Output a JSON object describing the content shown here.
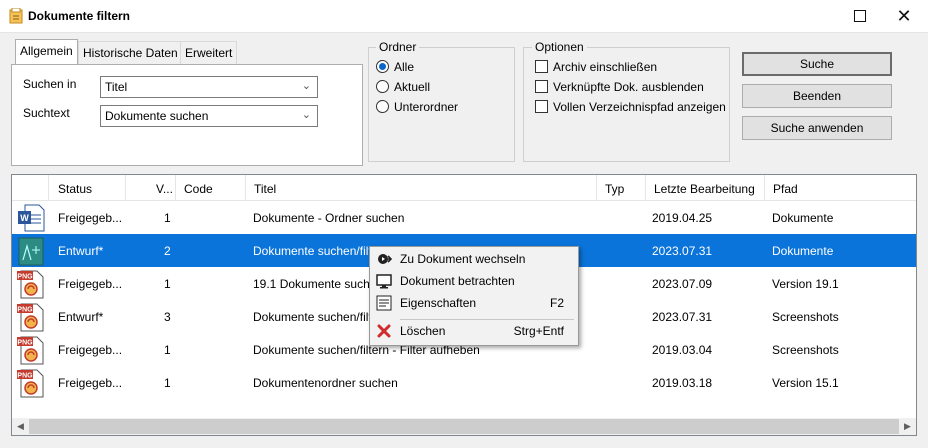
{
  "window": {
    "title": "Dokumente filtern",
    "close_glyph": "✕"
  },
  "tabs": [
    {
      "label": "Allgemein",
      "active": true
    },
    {
      "label": "Historische Daten",
      "active": false
    },
    {
      "label": "Erweitert",
      "active": false
    }
  ],
  "search": {
    "in_label": "Suchen in",
    "in_value": "Titel",
    "text_label": "Suchtext",
    "text_value": "Dokumente suchen"
  },
  "ordner": {
    "legend": "Ordner",
    "options": [
      {
        "label": "Alle",
        "selected": true
      },
      {
        "label": "Aktuell",
        "selected": false
      },
      {
        "label": "Unterordner",
        "selected": false
      }
    ]
  },
  "optionen": {
    "legend": "Optionen",
    "options": [
      {
        "label": "Archiv einschließen",
        "checked": false
      },
      {
        "label": "Verknüpfte Dok. ausblenden",
        "checked": false
      },
      {
        "label": "Vollen Verzeichnispfad anzeigen",
        "checked": false
      }
    ]
  },
  "buttons": {
    "suche": "Suche",
    "beenden": "Beenden",
    "anwenden": "Suche anwenden"
  },
  "list": {
    "columns": [
      "Status",
      "V...",
      "Code",
      "Titel",
      "Typ",
      "Letzte Bearbeitung",
      "Pfad"
    ],
    "rows": [
      {
        "icon": "word-document-icon",
        "status": "Freigegeb...",
        "version": "1",
        "code": "",
        "title": "Dokumente - Ordner suchen",
        "type": "",
        "date": "2019.04.25",
        "path": "Dokumente",
        "selected": false
      },
      {
        "icon": "drawing-document-icon",
        "status": "Entwurf*",
        "version": "2",
        "code": "",
        "title": "Dokumente suchen/filtern",
        "type": "",
        "date": "2023.07.31",
        "path": "Dokumente",
        "selected": true
      },
      {
        "icon": "png-image-icon",
        "status": "Freigegeb...",
        "version": "1",
        "code": "",
        "title": "19.1 Dokumente suchen",
        "type": "",
        "date": "2023.07.09",
        "path": "Version 19.1",
        "selected": false
      },
      {
        "icon": "png-image-icon",
        "status": "Entwurf*",
        "version": "3",
        "code": "",
        "title": "Dokumente suchen/filtern",
        "type": "",
        "date": "2023.07.31",
        "path": "Screenshots",
        "selected": false
      },
      {
        "icon": "png-image-icon",
        "status": "Freigegeb...",
        "version": "1",
        "code": "",
        "title": "Dokumente suchen/filtern - Filter aufheben",
        "type": "",
        "date": "2019.03.04",
        "path": "Screenshots",
        "selected": false
      },
      {
        "icon": "png-image-icon",
        "status": "Freigegeb...",
        "version": "1",
        "code": "",
        "title": "Dokumentenordner suchen",
        "type": "",
        "date": "2019.03.18",
        "path": "Version 15.1",
        "selected": false
      }
    ]
  },
  "context_menu": {
    "items": [
      {
        "label": "Zu Dokument wechseln",
        "shortcut": "",
        "icon": "switch-document-icon"
      },
      {
        "label": "Dokument betrachten",
        "shortcut": "",
        "icon": "monitor-icon"
      },
      {
        "label": "Eigenschaften",
        "shortcut": "F2",
        "icon": "properties-icon"
      },
      {
        "label": "Löschen",
        "shortcut": "Strg+Entf",
        "icon": "delete-icon"
      }
    ]
  },
  "colors": {
    "selection": "#0a74da",
    "radio_dot": "#0a64c9",
    "delete_red": "#d12b2b"
  }
}
